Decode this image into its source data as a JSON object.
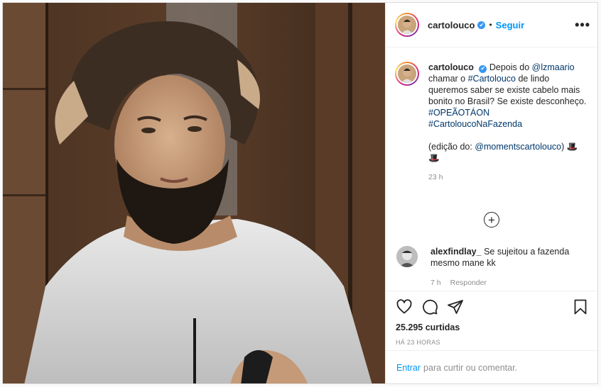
{
  "post": {
    "author": "cartolouco",
    "follow_label": "Seguir",
    "separator": "•",
    "more_label": "•••",
    "verified_mark": "✔"
  },
  "caption": {
    "author": "cartolouco",
    "parts": {
      "t1": "Depois do ",
      "mention1": "@lzmaario",
      "t2": " chamar o ",
      "hashtag1": "#Cartolouco",
      "t3": " de lindo queremos saber se existe cabelo mais bonito no Brasil? Se existe desconheço.",
      "hashtag2": "#OPEÃOTÁON",
      "hashtag3": "#CartoloucoNaFazenda",
      "t4": "(edição do: ",
      "mention2": "@momentscartolouco",
      "t5": ") ",
      "emoji1": "🎩",
      "emoji2": "🎩"
    },
    "time": "23 h"
  },
  "load_more_label": "+",
  "reply": {
    "author": "alexfindlay_",
    "text": "Se sujeitou a fazenda mesmo mane kk",
    "time": "7 h",
    "reply_label": "Responder"
  },
  "stats": {
    "likes": "25.295 curtidas",
    "posted": "HÁ 23 HORAS"
  },
  "add_comment": {
    "login_label": "Entrar",
    "text": "para curtir ou comentar."
  },
  "icons": [
    "heart-icon",
    "comment-icon",
    "share-icon",
    "bookmark-icon"
  ],
  "colors": {
    "link": "#00376b",
    "accent": "#0095f6",
    "verified": "#3897f0",
    "muted": "#8e8e8e"
  }
}
